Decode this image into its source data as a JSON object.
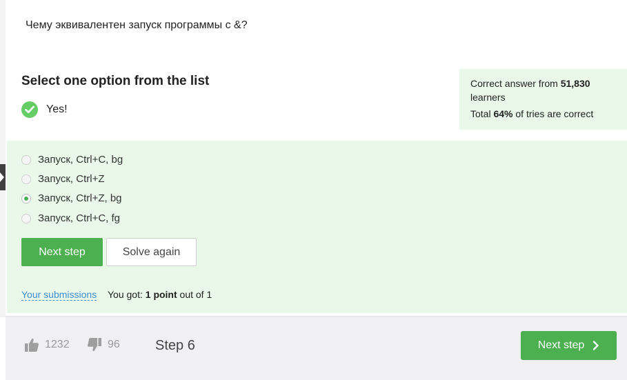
{
  "question": {
    "text": "Чему эквивалентен запуск программы с &?"
  },
  "quiz": {
    "title": "Select one option from the list",
    "verdict": "Yes!",
    "options": [
      {
        "label": "Запуск, Ctrl+C, bg",
        "selected": false
      },
      {
        "label": "Запуск, Ctrl+Z",
        "selected": false
      },
      {
        "label": "Запуск, Ctrl+Z, bg",
        "selected": true
      },
      {
        "label": "Запуск, Ctrl+C, fg",
        "selected": false
      }
    ],
    "next_label": "Next step",
    "solve_again_label": "Solve again",
    "submissions_label": "Your submissions",
    "points_prefix": "You got: ",
    "points_value": "1 point",
    "points_suffix": " out of 1"
  },
  "stats": {
    "correct_prefix": "Correct answer from ",
    "learners_count": "51,830",
    "learners_suffix": " learners",
    "total_prefix": "Total ",
    "percent": "64%",
    "total_suffix": " of tries are correct"
  },
  "footer": {
    "likes": "1232",
    "dislikes": "96",
    "step_label": "Step 6",
    "next_label": "Next step"
  },
  "colors": {
    "accent_green": "#4caf50",
    "panel_green": "#e9f8e9",
    "check_green": "#66cc66",
    "link_blue": "#3f8fd2"
  },
  "icons": [
    "check-circle-icon",
    "thumbs-up-icon",
    "thumbs-down-icon",
    "chevron-right-icon",
    "chevron-left-icon"
  ]
}
